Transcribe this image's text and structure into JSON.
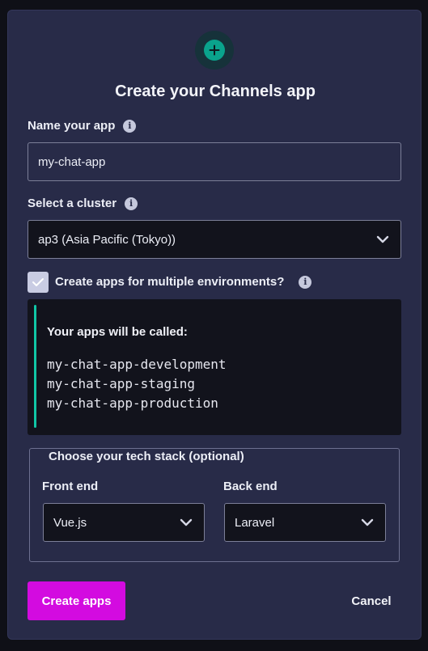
{
  "modal": {
    "title": "Create your Channels app"
  },
  "name_field": {
    "label": "Name your app",
    "value": "my-chat-app"
  },
  "cluster_field": {
    "label": "Select a cluster",
    "selected": "ap3 (Asia Pacific (Tokyo))"
  },
  "multi_env": {
    "label": "Create apps for multiple environments?",
    "checked": true
  },
  "app_names": {
    "heading": "Your apps will be called:",
    "names": [
      "my-chat-app-development",
      "my-chat-app-staging",
      "my-chat-app-production"
    ]
  },
  "tech_stack": {
    "legend": "Choose your tech stack (optional)",
    "frontend_label": "Front end",
    "frontend_value": "Vue.js",
    "backend_label": "Back end",
    "backend_value": "Laravel"
  },
  "actions": {
    "create_label": "Create apps",
    "cancel_label": "Cancel"
  },
  "colors": {
    "modal_bg": "#282b48",
    "accent_teal": "#10c6a6",
    "primary_button": "#d30be0"
  },
  "icons": {
    "header": "plus-circle-icon",
    "info": "info-icon",
    "select": "chevron-down-icon",
    "checkbox": "check-icon"
  }
}
